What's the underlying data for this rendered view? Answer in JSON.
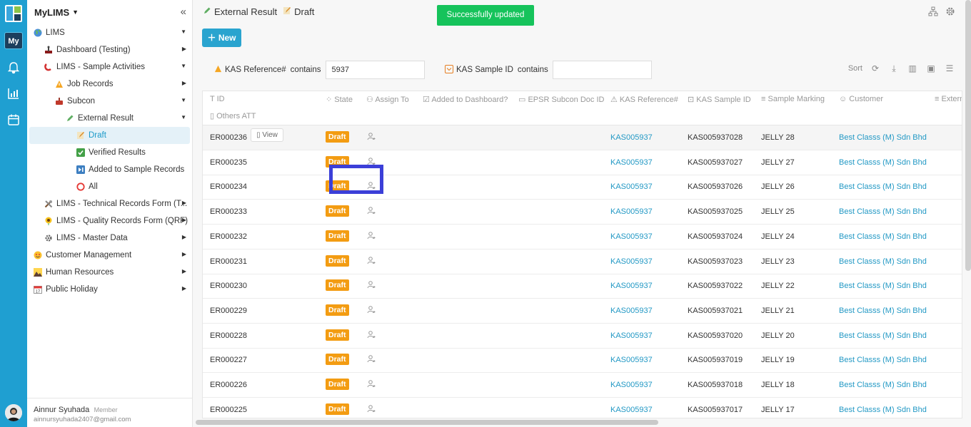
{
  "app": {
    "name": "MyLIMS",
    "rail_my": "My"
  },
  "breadcrumb": {
    "part1": "External Result",
    "part2": "Draft"
  },
  "toast": "Successfully updated",
  "new_button": "New",
  "filters": [
    {
      "label": "KAS Reference#",
      "op": "contains",
      "value": "5937"
    },
    {
      "label": "KAS Sample ID",
      "op": "contains",
      "value": ""
    }
  ],
  "tools": {
    "sort": "Sort"
  },
  "sidebar": {
    "items": [
      {
        "label": "LIMS",
        "icon": "globe-icon",
        "level": 0
      },
      {
        "label": "Dashboard (Testing)",
        "icon": "chart-icon",
        "level": 1
      },
      {
        "label": "LIMS - Sample Activities",
        "icon": "magnet-icon",
        "level": 1
      },
      {
        "label": "Job Records",
        "icon": "warning-icon",
        "level": 2
      },
      {
        "label": "Subcon",
        "icon": "flask-icon",
        "level": 2
      },
      {
        "label": "External Result",
        "icon": "pencil-icon",
        "level": 3
      },
      {
        "label": "Draft",
        "icon": "memo-icon",
        "level": 4
      },
      {
        "label": "Verified Results",
        "icon": "check-icon",
        "level": 4
      },
      {
        "label": "Added to Sample Records",
        "icon": "next-icon",
        "level": 4
      },
      {
        "label": "All",
        "icon": "circle-icon",
        "level": 4
      },
      {
        "label": "LIMS - Technical Records Form (T...",
        "icon": "tools-icon",
        "level": 1
      },
      {
        "label": "LIMS - Quality Records Form (QRF)",
        "icon": "sunflower-icon",
        "level": 1
      },
      {
        "label": "LIMS - Master Data",
        "icon": "gear-icon",
        "level": 1
      },
      {
        "label": "Customer Management",
        "icon": "smile-icon",
        "level": 0
      },
      {
        "label": "Human Resources",
        "icon": "landscape-icon",
        "level": 0
      },
      {
        "label": "Public Holiday",
        "icon": "calendar-icon",
        "level": 0
      }
    ],
    "user": {
      "name": "Ainnur Syuhada",
      "role": "Member",
      "email": "ainnursyuhada2407@gmail.com"
    }
  },
  "table": {
    "headers": [
      "ID",
      "State",
      "Assign To",
      "Added to Dashboard?",
      "EPSR Subcon Doc ID",
      "KAS Reference#",
      "KAS Sample ID",
      "Sample Marking",
      "Customer",
      "Extern",
      "Others ATT"
    ],
    "view_label": "View",
    "rows": [
      {
        "id": "ER000236",
        "state": "Draft",
        "ref": "KAS005937",
        "sample_id": "KAS005937028",
        "marking": "JELLY 28",
        "customer": "Best Classs (M) Sdn Bhd"
      },
      {
        "id": "ER000235",
        "state": "Draft",
        "ref": "KAS005937",
        "sample_id": "KAS005937027",
        "marking": "JELLY 27",
        "customer": "Best Classs (M) Sdn Bhd"
      },
      {
        "id": "ER000234",
        "state": "Draft",
        "ref": "KAS005937",
        "sample_id": "KAS005937026",
        "marking": "JELLY 26",
        "customer": "Best Classs (M) Sdn Bhd"
      },
      {
        "id": "ER000233",
        "state": "Draft",
        "ref": "KAS005937",
        "sample_id": "KAS005937025",
        "marking": "JELLY 25",
        "customer": "Best Classs (M) Sdn Bhd"
      },
      {
        "id": "ER000232",
        "state": "Draft",
        "ref": "KAS005937",
        "sample_id": "KAS005937024",
        "marking": "JELLY 24",
        "customer": "Best Classs (M) Sdn Bhd"
      },
      {
        "id": "ER000231",
        "state": "Draft",
        "ref": "KAS005937",
        "sample_id": "KAS005937023",
        "marking": "JELLY 23",
        "customer": "Best Classs (M) Sdn Bhd"
      },
      {
        "id": "ER000230",
        "state": "Draft",
        "ref": "KAS005937",
        "sample_id": "KAS005937022",
        "marking": "JELLY 22",
        "customer": "Best Classs (M) Sdn Bhd"
      },
      {
        "id": "ER000229",
        "state": "Draft",
        "ref": "KAS005937",
        "sample_id": "KAS005937021",
        "marking": "JELLY 21",
        "customer": "Best Classs (M) Sdn Bhd"
      },
      {
        "id": "ER000228",
        "state": "Draft",
        "ref": "KAS005937",
        "sample_id": "KAS005937020",
        "marking": "JELLY 20",
        "customer": "Best Classs (M) Sdn Bhd"
      },
      {
        "id": "ER000227",
        "state": "Draft",
        "ref": "KAS005937",
        "sample_id": "KAS005937019",
        "marking": "JELLY 19",
        "customer": "Best Classs (M) Sdn Bhd"
      },
      {
        "id": "ER000226",
        "state": "Draft",
        "ref": "KAS005937",
        "sample_id": "KAS005937018",
        "marking": "JELLY 18",
        "customer": "Best Classs (M) Sdn Bhd"
      },
      {
        "id": "ER000225",
        "state": "Draft",
        "ref": "KAS005937",
        "sample_id": "KAS005937017",
        "marking": "JELLY 17",
        "customer": "Best Classs (M) Sdn Bhd"
      }
    ]
  },
  "colors": {
    "accent": "#1f9fd1",
    "draft": "#f39c12",
    "toast": "#16c35b",
    "highlight": "#3b3fd8",
    "link": "#2399c5"
  }
}
